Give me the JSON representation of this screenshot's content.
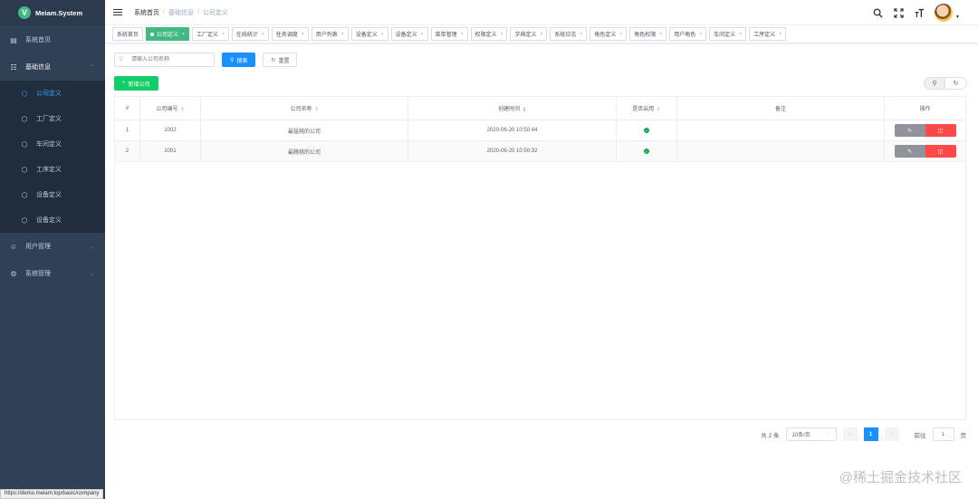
{
  "app": {
    "logo_letter": "V",
    "title": "Meiam.System"
  },
  "sidebar": {
    "items": [
      {
        "label": "系统首页",
        "icon": "dashboard-icon"
      },
      {
        "label": "基础信息",
        "icon": "sitemap-icon"
      }
    ],
    "submenu": [
      {
        "label": "公司定义",
        "active": true
      },
      {
        "label": "工厂定义"
      },
      {
        "label": "车间定义"
      },
      {
        "label": "工序定义"
      },
      {
        "label": "设备定义"
      },
      {
        "label": "设备定义"
      }
    ],
    "bottom_items": [
      {
        "label": "用户管理",
        "icon": "users-icon"
      },
      {
        "label": "系统管理",
        "icon": "gear-icon"
      }
    ]
  },
  "header": {
    "breadcrumb": [
      "系统首页",
      "基础信息",
      "公司定义"
    ],
    "separator": "/"
  },
  "tags": [
    {
      "label": "系统首页",
      "closable": false,
      "active": false
    },
    {
      "label": "公司定义",
      "closable": true,
      "active": true
    },
    {
      "label": "工厂定义",
      "closable": true
    },
    {
      "label": "在线统计",
      "closable": true
    },
    {
      "label": "任务调度",
      "closable": true
    },
    {
      "label": "用户列表",
      "closable": true
    },
    {
      "label": "设备定义",
      "closable": true
    },
    {
      "label": "设备定义",
      "closable": true
    },
    {
      "label": "菜单管理",
      "closable": true
    },
    {
      "label": "权限定义",
      "closable": true
    },
    {
      "label": "字典定义",
      "closable": true
    },
    {
      "label": "系统日志",
      "closable": true
    },
    {
      "label": "角色定义",
      "closable": true
    },
    {
      "label": "角色权限",
      "closable": true
    },
    {
      "label": "用户角色",
      "closable": true
    },
    {
      "label": "车间定义",
      "closable": true
    },
    {
      "label": "工序定义",
      "closable": true
    }
  ],
  "search": {
    "placeholder": "请输入公司名称",
    "value": "",
    "search_label": "搜索",
    "reset_label": "重置",
    "add_label": "新增公司"
  },
  "table": {
    "columns": [
      "#",
      "公司编号",
      "公司名称",
      "创建时间",
      "是否启用",
      "备注",
      "操作"
    ],
    "rows": [
      {
        "index": "1",
        "code": "1002",
        "name": "最猛桃的公司",
        "created": "2020-06-20 10:50:44",
        "enabled": true,
        "remark": ""
      },
      {
        "index": "2",
        "code": "1001",
        "name": "最腾桃的公司",
        "created": "2020-06-20 10:50:32",
        "enabled": true,
        "remark": ""
      }
    ]
  },
  "pagination": {
    "total_text": "共 2 条",
    "page_size": "10条/页",
    "current_page": "1",
    "goto_label": "前往",
    "goto_value": "1",
    "page_suffix": "页"
  },
  "status_url": "https://demo.meiam.top/basic/company",
  "watermark": "@稀土掘金技术社区",
  "colors": {
    "sidebar_bg": "#304156",
    "accent": "#409eff",
    "tag_active": "#42b983",
    "primary_btn": "#1890ff",
    "success_btn": "#13ce66",
    "danger_btn": "#ff4949"
  }
}
